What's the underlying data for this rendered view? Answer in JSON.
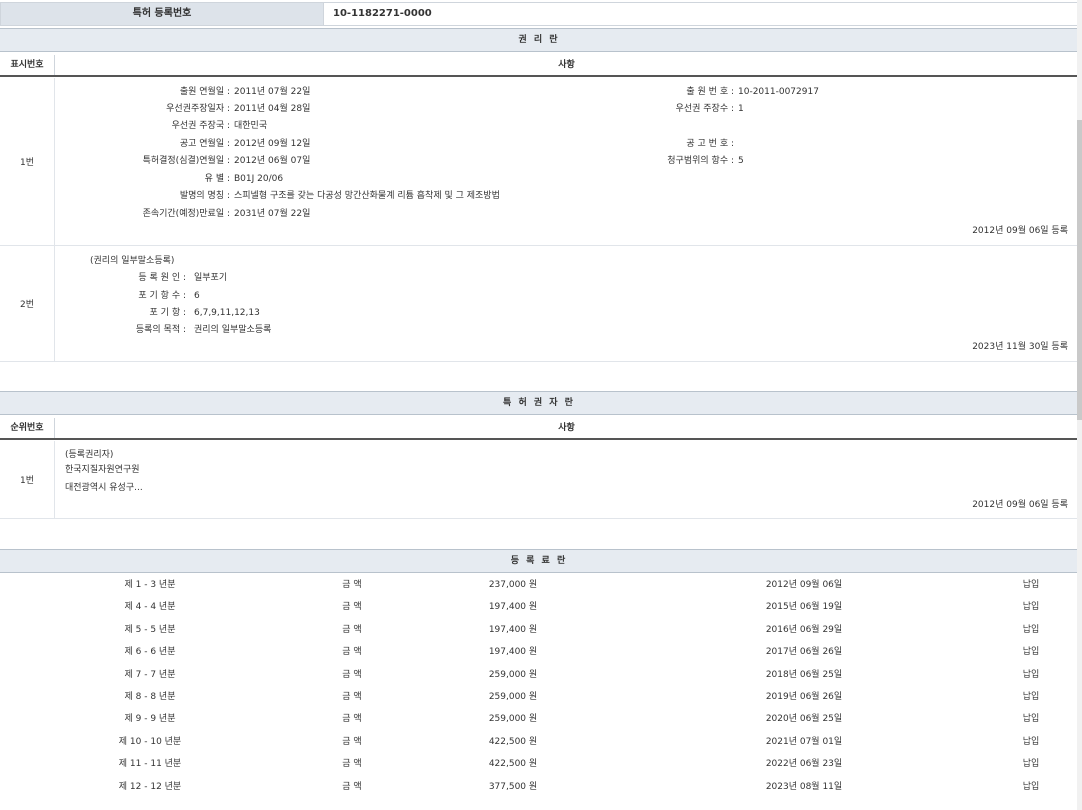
{
  "header": {
    "reg_label": "특허 등록번호",
    "reg_value": "10-1182271-0000"
  },
  "rights": {
    "title": "권 리 란",
    "col_num": "표시번호",
    "col_matter": "사항",
    "row1": {
      "num": "1번",
      "app_date_label": "출원 연월일 :",
      "app_date": "2011년 07월 22일",
      "app_no_label": "출 원 번 호 :",
      "app_no": "10-2011-0072917",
      "prio_date_label": "우선권주장일자 :",
      "prio_date": "2011년 04월 28일",
      "prio_count_label": "우선권 주장수 :",
      "prio_count": "1",
      "prio_country_label": "우선권 주장국 :",
      "prio_country": "대한민국",
      "pub_date_label": "공고 연월일 :",
      "pub_date": "2012년 09월 12일",
      "pub_no_label": "공 고 번 호 :",
      "pub_no": "",
      "decision_label": "특허결정(심결)연월일 :",
      "decision": "2012년 06월 07일",
      "claims_label": "청구범위의 항수 :",
      "claims": "5",
      "class_label": "유 별 :",
      "class": "B01J 20/06",
      "title_label": "발명의 명칭 :",
      "invention_title": "스피넬형 구조를 갖는 다공성 망간산화물계 리튬 흡착제 및 그 제조방법",
      "expiry_label": "존속기간(예정)만료일 :",
      "expiry": "2031년 07월 22일",
      "reg_date": "2012년 09월 06일 등록"
    },
    "row2": {
      "num": "2번",
      "heading": "(권리의 일부말소등록)",
      "cause_label": "등 록 원 인 :",
      "cause": "일부포기",
      "waived_count_label": "포 기 항 수 :",
      "waived_count": "6",
      "waived_label": "포 기 항 :",
      "waived": "6,7,9,11,12,13",
      "purpose_label": "등록의 목적 :",
      "purpose": "권리의 일부말소등록",
      "reg_date": "2023년 11월 30일 등록"
    }
  },
  "holders": {
    "title": "특 허 권 자 란",
    "col_num": "순위번호",
    "col_matter": "사항",
    "row1": {
      "num": "1번",
      "heading": "(등록권리자)",
      "name": "한국지질자원연구원",
      "address": "대전광역시 유성구...",
      "reg_date": "2012년 09월 06일 등록"
    }
  },
  "fees": {
    "title": "등 록 료 란",
    "rows": [
      {
        "period": "제 1 - 3 년분",
        "label": "금 액",
        "amount": "237,000 원",
        "date": "2012년 09월 06일",
        "status": "납입"
      },
      {
        "period": "제 4 - 4 년분",
        "label": "금 액",
        "amount": "197,400 원",
        "date": "2015년 06월 19일",
        "status": "납입"
      },
      {
        "period": "제 5 - 5 년분",
        "label": "금 액",
        "amount": "197,400 원",
        "date": "2016년 06월 29일",
        "status": "납입"
      },
      {
        "period": "제 6 - 6 년분",
        "label": "금 액",
        "amount": "197,400 원",
        "date": "2017년 06월 26일",
        "status": "납입"
      },
      {
        "period": "제 7 - 7 년분",
        "label": "금 액",
        "amount": "259,000 원",
        "date": "2018년 06월 25일",
        "status": "납입"
      },
      {
        "period": "제 8 - 8 년분",
        "label": "금 액",
        "amount": "259,000 원",
        "date": "2019년 06월 26일",
        "status": "납입"
      },
      {
        "period": "제 9 - 9 년분",
        "label": "금 액",
        "amount": "259,000 원",
        "date": "2020년 06월 25일",
        "status": "납입"
      },
      {
        "period": "제 10 - 10 년분",
        "label": "금 액",
        "amount": "422,500 원",
        "date": "2021년 07월 01일",
        "status": "납입"
      },
      {
        "period": "제 11 - 11 년분",
        "label": "금 액",
        "amount": "422,500 원",
        "date": "2022년 06월 23일",
        "status": "납입"
      },
      {
        "period": "제 12 - 12 년분",
        "label": "금 액",
        "amount": "377,500 원",
        "date": "2023년 08월 11일",
        "status": "납입"
      }
    ]
  }
}
